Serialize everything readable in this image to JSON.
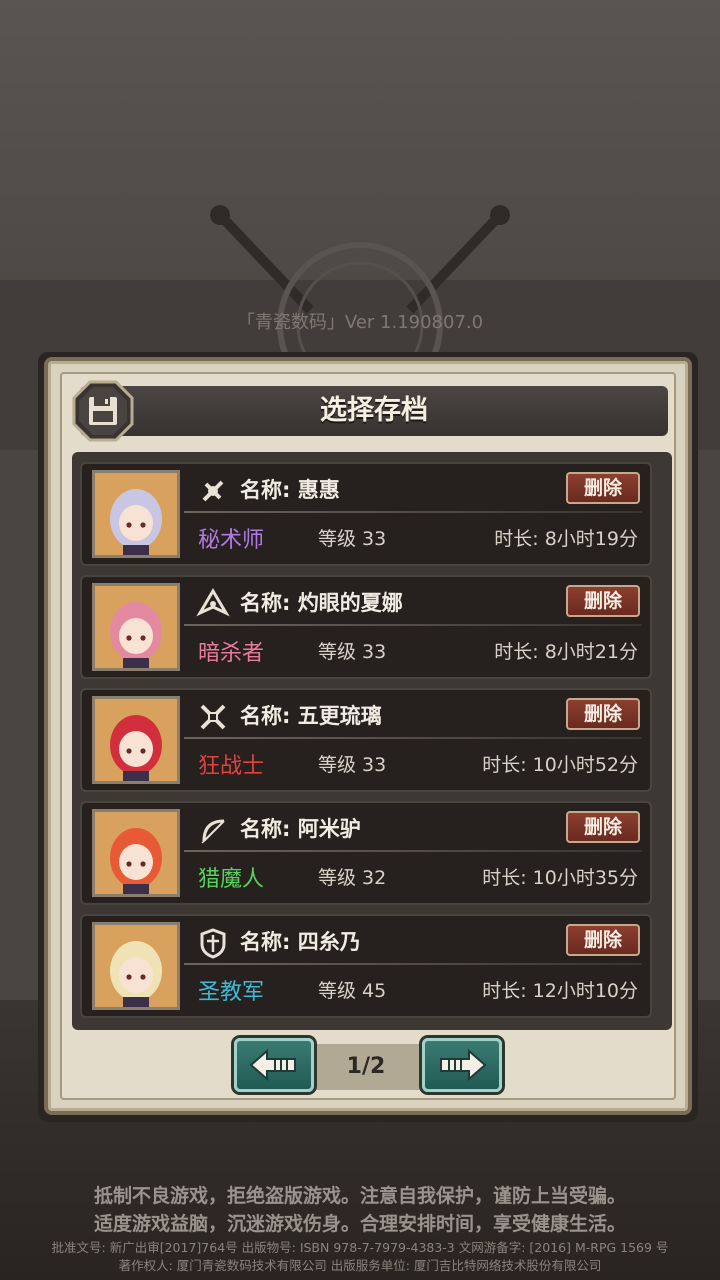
{
  "version_text": "「青瓷数码」Ver 1.190807.0",
  "dialog": {
    "title": "选择存档",
    "icon": "floppy-disk-icon"
  },
  "labels": {
    "name_prefix": "名称: ",
    "delete": "删除"
  },
  "saves": [
    {
      "name": "名称: 惠惠",
      "class": "秘术师",
      "class_color": "#b07be0",
      "class_icon": "arcanist-icon",
      "level": "等级 33",
      "duration": "时长: 8小时19分",
      "portrait_hair": "#c9c6e3",
      "portrait_bg": "#d9a15e"
    },
    {
      "name": "名称: 灼眼的夏娜",
      "class": "暗杀者",
      "class_color": "#e97aa0",
      "class_icon": "assassin-icon",
      "level": "等级 33",
      "duration": "时长: 8小时21分",
      "portrait_hair": "#e48aa0",
      "portrait_bg": "#d9a15e"
    },
    {
      "name": "名称: 五更琉璃",
      "class": "狂战士",
      "class_color": "#e0433d",
      "class_icon": "berserker-icon",
      "level": "等级 33",
      "duration": "时长: 10小时52分",
      "portrait_hair": "#d22f3c",
      "portrait_bg": "#d9a15e"
    },
    {
      "name": "名称: 阿米驴",
      "class": "猎魔人",
      "class_color": "#55d35a",
      "class_icon": "demon-hunter-bow-icon",
      "level": "等级 32",
      "duration": "时长: 10小时35分",
      "portrait_hair": "#e85a35",
      "portrait_bg": "#d9a15e"
    },
    {
      "name": "名称: 四糸乃",
      "class": "圣教军",
      "class_color": "#3fb9d6",
      "class_icon": "crusader-shield-icon",
      "level": "等级 45",
      "duration": "时长: 12小时10分",
      "portrait_hair": "#efe3b5",
      "portrait_bg": "#d9a15e"
    }
  ],
  "pager": {
    "indicator": "1/2",
    "prev_icon": "arrow-left-icon",
    "next_icon": "arrow-right-icon"
  },
  "notice": {
    "line1": "抵制不良游戏，拒绝盗版游戏。注意自我保护，谨防上当受骗。",
    "line2": "适度游戏益脑，沉迷游戏伤身。合理安排时间，享受健康生活。",
    "legal1": "批准文号: 新广出审[2017]764号 出版物号: ISBN 978-7-7979-4383-3 文网游备字: [2016] M-RPG 1569 号",
    "legal2": "著作权人: 厦门青瓷数码技术有限公司 出版服务单位: 厦门吉比特网络技术股份有限公司"
  }
}
